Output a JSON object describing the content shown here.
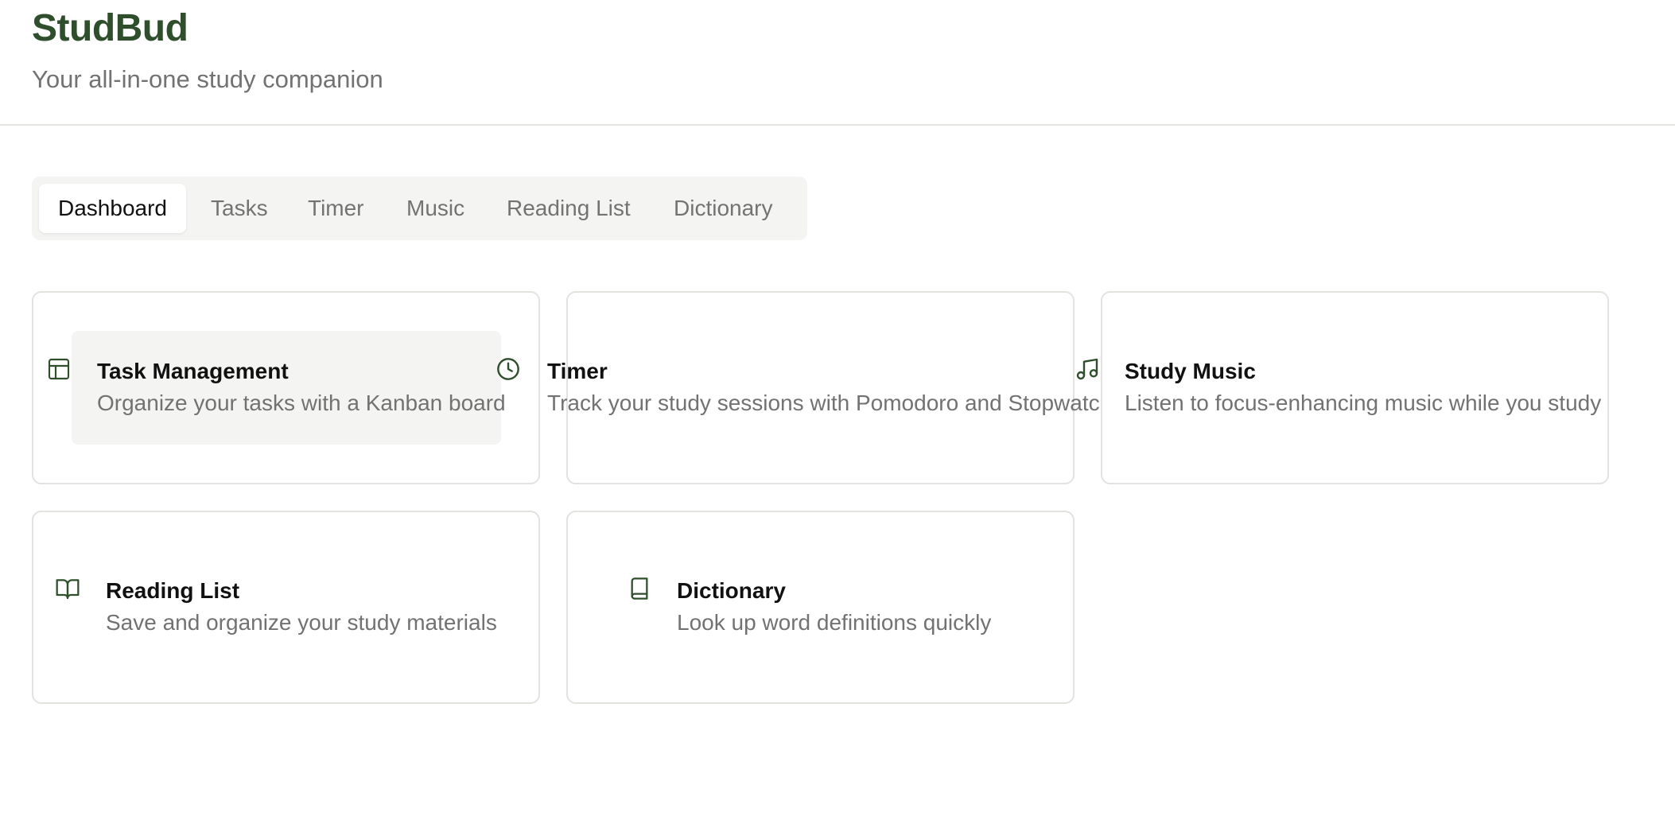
{
  "header": {
    "title": "StudBud",
    "subtitle": "Your all-in-one study companion"
  },
  "tabs": [
    {
      "label": "Dashboard",
      "active": true
    },
    {
      "label": "Tasks",
      "active": false
    },
    {
      "label": "Timer",
      "active": false
    },
    {
      "label": "Music",
      "active": false
    },
    {
      "label": "Reading List",
      "active": false
    },
    {
      "label": "Dictionary",
      "active": false
    }
  ],
  "cards": [
    {
      "icon": "layout-icon",
      "title": "Task Management",
      "description": "Organize your tasks with a Kanban board"
    },
    {
      "icon": "clock-icon",
      "title": "Timer",
      "description": "Track your study sessions with Pomodoro and Stopwatch"
    },
    {
      "icon": "music-icon",
      "title": "Study Music",
      "description": "Listen to focus-enhancing music while you study"
    },
    {
      "icon": "book-open-icon",
      "title": "Reading List",
      "description": "Save and organize your study materials"
    },
    {
      "icon": "book-icon",
      "title": "Dictionary",
      "description": "Look up word definitions quickly"
    }
  ],
  "colors": {
    "brand": "#2e4e2c",
    "icon": "#2e4e2c",
    "muted_text": "#727272",
    "tab_bar_bg": "#f4f4f2"
  }
}
